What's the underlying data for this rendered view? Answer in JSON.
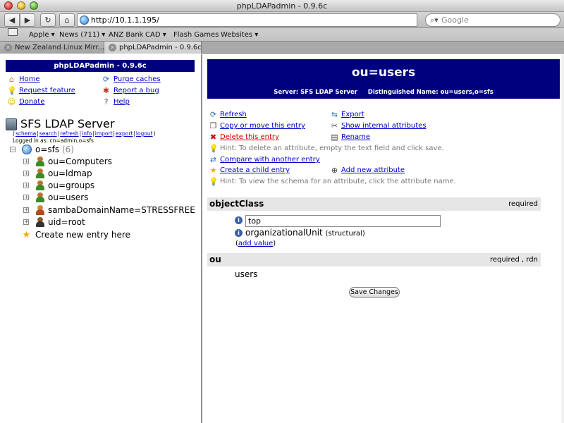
{
  "window": {
    "title": "phpLDAPadmin - 0.9.6c"
  },
  "toolbar": {
    "url": "http://10.1.1.195/",
    "search_placeholder": "Google"
  },
  "bookmarks": [
    "Apple ▾",
    "News (711) ▾",
    "ANZ Bank",
    "CAD ▾",
    "Flash Games",
    "Websites ▾"
  ],
  "tabs": [
    {
      "label": "New Zealand Linux Mirr..."
    },
    {
      "label": "phpLDAPadmin - 0.9.6c"
    }
  ],
  "left": {
    "header": "phpLDAPadmin - 0.9.6c",
    "menu": {
      "home": "Home",
      "purge": "Purge caches",
      "request": "Request feature",
      "report": "Report a bug",
      "donate": "Donate",
      "help": "Help"
    },
    "server_title": "SFS LDAP Server",
    "server_links": [
      "schema",
      "search",
      "refresh",
      "info",
      "import",
      "export",
      "logout"
    ],
    "logged_in": "Logged in as: cn=admin,o=sfs",
    "tree": {
      "root": {
        "label": "o=sfs",
        "count": "(6)"
      },
      "children": [
        {
          "label": "ou=Computers"
        },
        {
          "label": "ou=ldmap"
        },
        {
          "label": "ou=groups"
        },
        {
          "label": "ou=users"
        },
        {
          "label": "sambaDomainName=STRESSFREE"
        },
        {
          "label": "uid=root"
        }
      ],
      "create": "Create new entry here"
    }
  },
  "right": {
    "title": "ou=users",
    "server_label": "Server: SFS LDAP Server",
    "dn_label": "Distinguished Name: ou=users,o=sfs",
    "actions": {
      "refresh": "Refresh",
      "export": "Export",
      "copy": "Copy or move this entry",
      "show_internal": "Show internal attributes",
      "delete": "Delete this entry",
      "rename": "Rename",
      "hint_delete": "Hint: To delete an attribute, empty the text field and click save.",
      "compare": "Compare with another entry",
      "create_child": "Create a child entry",
      "add_attr": "Add new attribute",
      "hint_schema": "Hint: To view the schema for an attribute, click the attribute name."
    },
    "attributes": {
      "objectclass": {
        "name": "objectClass",
        "flags": "required",
        "value_input": "top",
        "value2": "organizationalUnit",
        "value2_note": "(structural)",
        "add_value": "add value"
      },
      "ou": {
        "name": "ou",
        "flags": "required ,  rdn",
        "value": "users"
      }
    },
    "save": "Save Changes"
  }
}
